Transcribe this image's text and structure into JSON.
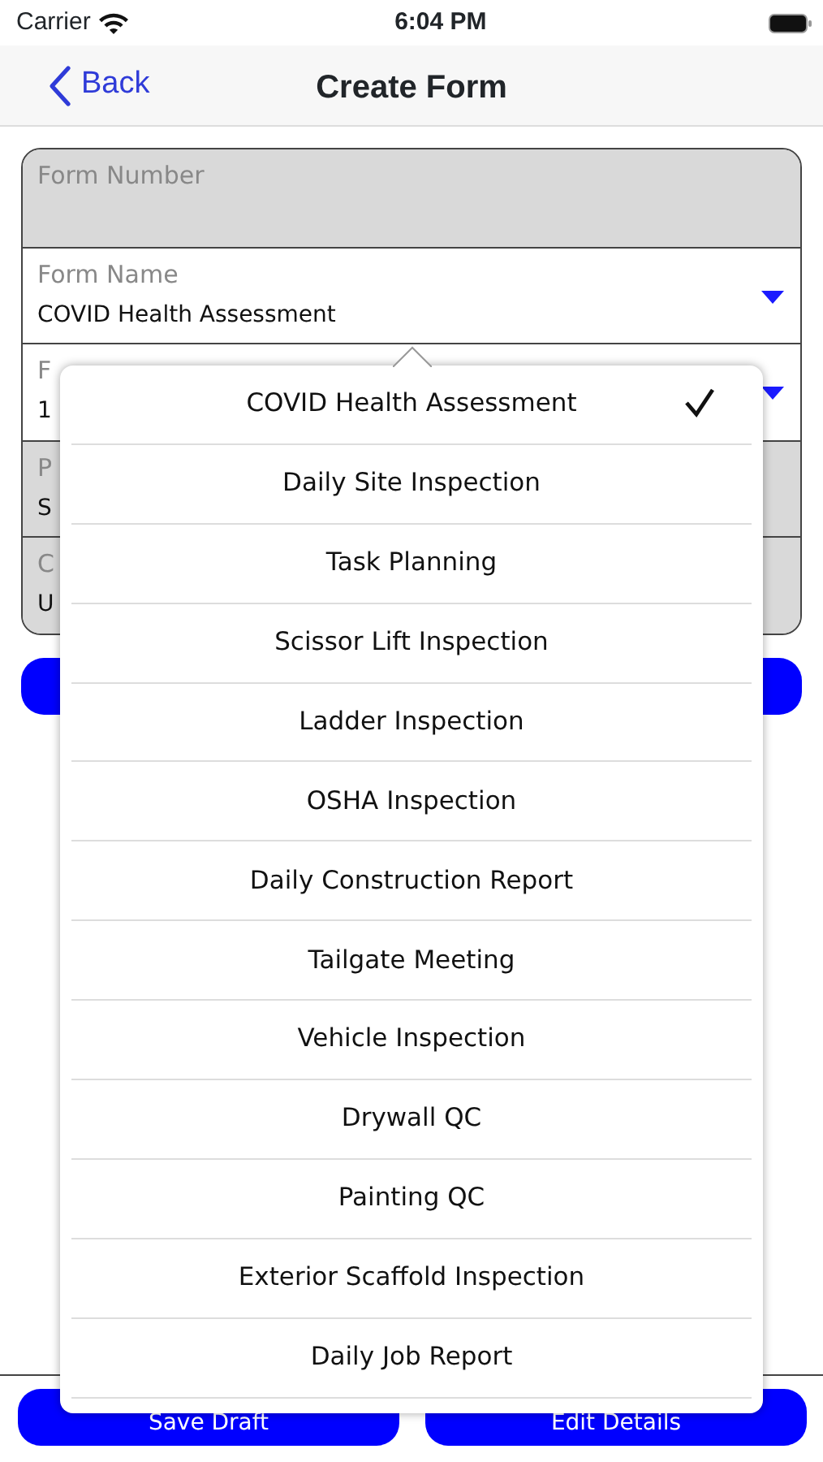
{
  "status_bar": {
    "carrier": "Carrier",
    "time": "6:04 PM"
  },
  "nav": {
    "back": "Back",
    "title": "Create Form"
  },
  "fields": [
    {
      "label": "Form Number",
      "disabled": true,
      "dropdown": false
    },
    {
      "label": "Form Name",
      "value": "COVID Health Assessment",
      "disabled": false,
      "dropdown": true
    },
    {
      "label": "F",
      "value": "1",
      "disabled": false,
      "dropdown": true
    },
    {
      "label": "P",
      "value": "S",
      "disabled": true,
      "dropdown": false
    },
    {
      "label": "C",
      "value": "U",
      "disabled": true,
      "dropdown": false
    }
  ],
  "buttons": [
    "Save Draft",
    "Edit Details"
  ],
  "menu": [
    {
      "label": "COVID Health Assessment",
      "selected": true
    },
    {
      "label": "Daily Site Inspection",
      "selected": false
    },
    {
      "label": "Task Planning",
      "selected": false
    },
    {
      "label": "Scissor Lift Inspection",
      "selected": false
    },
    {
      "label": "Ladder Inspection",
      "selected": false
    },
    {
      "label": "OSHA Inspection",
      "selected": false
    },
    {
      "label": "Daily Construction Report",
      "selected": false
    },
    {
      "label": "Tailgate Meeting",
      "selected": false
    },
    {
      "label": "Vehicle Inspection",
      "selected": false
    },
    {
      "label": "Drywall QC",
      "selected": false
    },
    {
      "label": "Painting QC",
      "selected": false
    },
    {
      "label": "Exterior Scaffold Inspection",
      "selected": false
    },
    {
      "label": "Daily Job Report",
      "selected": false
    }
  ]
}
